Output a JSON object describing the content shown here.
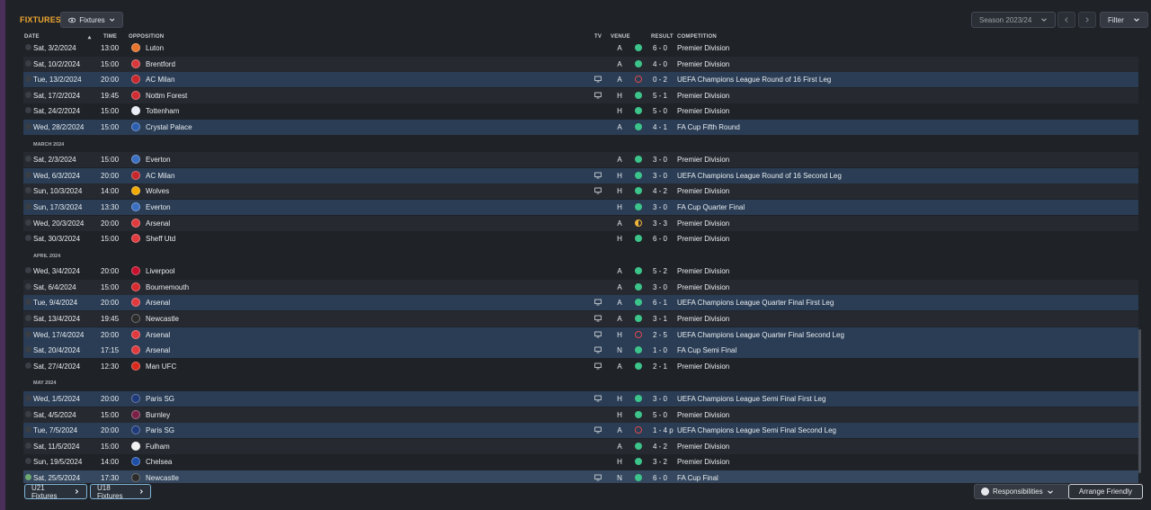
{
  "header": {
    "title": "FIXTURES",
    "view_dropdown": "Fixtures",
    "season": "Season 2023/24",
    "filter": "Filter"
  },
  "columns": {
    "date": "DATE",
    "time": "TIME",
    "opposition": "OPPOSITION",
    "tv": "TV",
    "venue": "VENUE",
    "result": "RESULT",
    "competition": "COMPETITION"
  },
  "colors": {
    "accent": "#f0a830",
    "win": "#3cc48a",
    "loss": "#e0474c",
    "draw": "#f1b43a",
    "highlight_row": "#2a3d55"
  },
  "rows": [
    {
      "kind": "match",
      "date": "Sat, 3/2/2024",
      "time": "13:00",
      "opp": "Luton",
      "tv": false,
      "venue": "A",
      "result": "win",
      "score": "6 - 0",
      "comp": "Premier Division",
      "hl": false,
      "badge": "#e8742c"
    },
    {
      "kind": "match",
      "date": "Sat, 10/2/2024",
      "time": "15:00",
      "opp": "Brentford",
      "tv": false,
      "venue": "A",
      "result": "win",
      "score": "4 - 0",
      "comp": "Premier Division",
      "hl": false,
      "badge": "#d9383b"
    },
    {
      "kind": "match",
      "date": "Tue, 13/2/2024",
      "time": "20:00",
      "opp": "AC Milan",
      "tv": true,
      "venue": "A",
      "result": "loss",
      "score": "0 - 2",
      "comp": "UEFA Champions League Round of 16  First Leg",
      "hl": true,
      "badge": "#c8262b"
    },
    {
      "kind": "match",
      "date": "Sat, 17/2/2024",
      "time": "19:45",
      "opp": "Nottm Forest",
      "tv": true,
      "venue": "H",
      "result": "win",
      "score": "5 - 1",
      "comp": "Premier Division",
      "hl": false,
      "badge": "#d12c33"
    },
    {
      "kind": "match",
      "date": "Sat, 24/2/2024",
      "time": "15:00",
      "opp": "Tottenham",
      "tv": false,
      "venue": "H",
      "result": "win",
      "score": "5 - 0",
      "comp": "Premier Division",
      "hl": false,
      "badge": "#e9edf5"
    },
    {
      "kind": "match",
      "date": "Wed, 28/2/2024",
      "time": "15:00",
      "opp": "Crystal Palace",
      "tv": false,
      "venue": "A",
      "result": "win",
      "score": "4 - 1",
      "comp": "FA Cup Fifth Round",
      "hl": true,
      "badge": "#2c5fb0"
    },
    {
      "kind": "month",
      "label": "MARCH 2024"
    },
    {
      "kind": "match",
      "date": "Sat, 2/3/2024",
      "time": "15:00",
      "opp": "Everton",
      "tv": false,
      "venue": "A",
      "result": "win",
      "score": "3 - 0",
      "comp": "Premier Division",
      "hl": false,
      "badge": "#3a6fc2"
    },
    {
      "kind": "match",
      "date": "Wed, 6/3/2024",
      "time": "20:00",
      "opp": "AC Milan",
      "tv": true,
      "venue": "H",
      "result": "win",
      "score": "3 - 0",
      "comp": "UEFA Champions League Round of 16  Second Leg",
      "hl": true,
      "badge": "#c8262b"
    },
    {
      "kind": "match",
      "date": "Sun, 10/3/2024",
      "time": "14:00",
      "opp": "Wolves",
      "tv": true,
      "venue": "H",
      "result": "win",
      "score": "4 - 2",
      "comp": "Premier Division",
      "hl": false,
      "badge": "#f2a900"
    },
    {
      "kind": "match",
      "date": "Sun, 17/3/2024",
      "time": "13:30",
      "opp": "Everton",
      "tv": false,
      "venue": "H",
      "result": "win",
      "score": "3 - 0",
      "comp": "FA Cup Quarter Final",
      "hl": true,
      "badge": "#3a6fc2"
    },
    {
      "kind": "match",
      "date": "Wed, 20/3/2024",
      "time": "20:00",
      "opp": "Arsenal",
      "tv": false,
      "venue": "A",
      "result": "draw",
      "score": "3 - 3",
      "comp": "Premier Division",
      "hl": false,
      "badge": "#e03a3e"
    },
    {
      "kind": "match",
      "date": "Sat, 30/3/2024",
      "time": "15:00",
      "opp": "Sheff Utd",
      "tv": false,
      "venue": "H",
      "result": "win",
      "score": "6 - 0",
      "comp": "Premier Division",
      "hl": false,
      "badge": "#e03a3e"
    },
    {
      "kind": "month",
      "label": "APRIL 2024"
    },
    {
      "kind": "match",
      "date": "Wed, 3/4/2024",
      "time": "20:00",
      "opp": "Liverpool",
      "tv": false,
      "venue": "A",
      "result": "win",
      "score": "5 - 2",
      "comp": "Premier Division",
      "hl": false,
      "badge": "#c8102e"
    },
    {
      "kind": "match",
      "date": "Sat, 6/4/2024",
      "time": "15:00",
      "opp": "Bournemouth",
      "tv": false,
      "venue": "A",
      "result": "win",
      "score": "3 - 0",
      "comp": "Premier Division",
      "hl": false,
      "badge": "#d82a2f"
    },
    {
      "kind": "match",
      "date": "Tue, 9/4/2024",
      "time": "20:00",
      "opp": "Arsenal",
      "tv": true,
      "venue": "A",
      "result": "win",
      "score": "6 - 1",
      "comp": "UEFA Champions League Quarter Final First Leg",
      "hl": true,
      "badge": "#e03a3e"
    },
    {
      "kind": "match",
      "date": "Sat, 13/4/2024",
      "time": "19:45",
      "opp": "Newcastle",
      "tv": true,
      "venue": "A",
      "result": "win",
      "score": "3 - 1",
      "comp": "Premier Division",
      "hl": false,
      "badge": "#2b2b2b"
    },
    {
      "kind": "match",
      "date": "Wed, 17/4/2024",
      "time": "20:00",
      "opp": "Arsenal",
      "tv": true,
      "venue": "H",
      "result": "loss",
      "score": "2 - 5",
      "comp": "UEFA Champions League Quarter Final Second Leg",
      "hl": true,
      "badge": "#e03a3e"
    },
    {
      "kind": "match",
      "date": "Sat, 20/4/2024",
      "time": "17:15",
      "opp": "Arsenal",
      "tv": true,
      "venue": "N",
      "result": "win",
      "score": "1 - 0",
      "comp": "FA Cup Semi Final",
      "hl": true,
      "badge": "#e03a3e"
    },
    {
      "kind": "match",
      "date": "Sat, 27/4/2024",
      "time": "12:30",
      "opp": "Man UFC",
      "tv": true,
      "venue": "A",
      "result": "win",
      "score": "2 - 1",
      "comp": "Premier Division",
      "hl": false,
      "badge": "#da291c"
    },
    {
      "kind": "month",
      "label": "MAY 2024"
    },
    {
      "kind": "match",
      "date": "Wed, 1/5/2024",
      "time": "20:00",
      "opp": "Paris SG",
      "tv": true,
      "venue": "H",
      "result": "win",
      "score": "3 - 0",
      "comp": "UEFA Champions League Semi Final First Leg",
      "hl": true,
      "badge": "#1f3a7a"
    },
    {
      "kind": "match",
      "date": "Sat, 4/5/2024",
      "time": "15:00",
      "opp": "Burnley",
      "tv": false,
      "venue": "H",
      "result": "win",
      "score": "5 - 0",
      "comp": "Premier Division",
      "hl": false,
      "badge": "#7a2048"
    },
    {
      "kind": "match",
      "date": "Tue, 7/5/2024",
      "time": "20:00",
      "opp": "Paris SG",
      "tv": true,
      "venue": "A",
      "result": "loss",
      "score": "1 - 4 p",
      "comp": "UEFA Champions League Semi Final Second Leg",
      "hl": true,
      "badge": "#1f3a7a"
    },
    {
      "kind": "match",
      "date": "Sat, 11/5/2024",
      "time": "15:00",
      "opp": "Fulham",
      "tv": false,
      "venue": "A",
      "result": "win",
      "score": "4 - 2",
      "comp": "Premier Division",
      "hl": false,
      "badge": "#f2f2f2"
    },
    {
      "kind": "match",
      "date": "Sun, 19/5/2024",
      "time": "14:00",
      "opp": "Chelsea",
      "tv": false,
      "venue": "H",
      "result": "win",
      "score": "3 - 2",
      "comp": "Premier Division",
      "hl": false,
      "badge": "#1d4ea8"
    },
    {
      "kind": "match",
      "date": "Sat, 25/5/2024",
      "time": "17:30",
      "opp": "Newcastle",
      "tv": true,
      "venue": "N",
      "result": "win",
      "score": "6 - 0",
      "comp": "FA Cup Final",
      "hl": "last",
      "badge": "#2b2b2b"
    }
  ],
  "footer": {
    "u21": "U21 Fixtures",
    "u18": "U18 Fixtures",
    "responsibilities": "Responsibilities",
    "arrange": "Arrange Friendly"
  }
}
